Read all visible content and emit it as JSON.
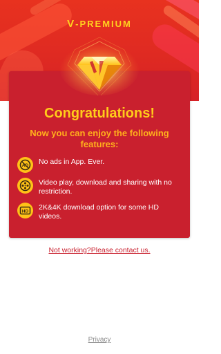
{
  "header": {
    "title_prefix": "V",
    "title_rest": "-PREMIUM"
  },
  "card": {
    "title": "Congratulations!",
    "subtitle": "Now you can enjoy the following features:",
    "features": [
      {
        "icon": "no-ads-icon",
        "text": "No ads in App. Ever."
      },
      {
        "icon": "film-reel-icon",
        "text": "Video play, download and sharing with no restriction."
      },
      {
        "icon": "hd-icon",
        "text": "2K&4K download option for some HD videos."
      }
    ]
  },
  "links": {
    "contact": "Not working?Please contact us.",
    "privacy": "Privacy"
  },
  "colors": {
    "header_red": "#e8321f",
    "card_red": "#c9202e",
    "gold": "#ffcc1a",
    "link_red": "#c9202e",
    "privacy_gray": "#8a8a8a"
  }
}
